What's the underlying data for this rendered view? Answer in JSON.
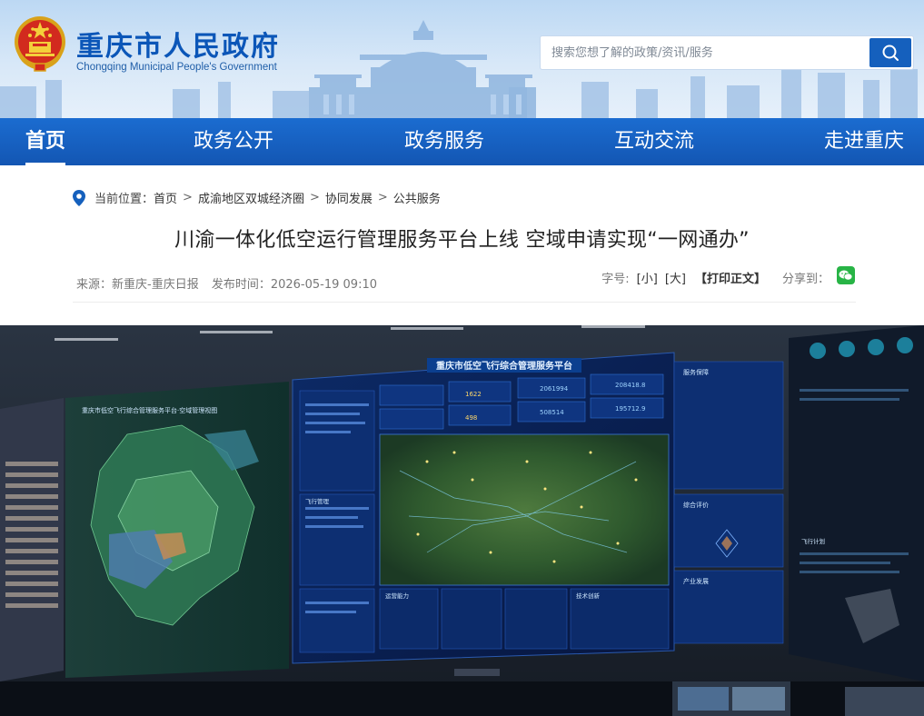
{
  "header": {
    "site_name": "重庆市人民政府",
    "site_name_en": "Chongqing Municipal People's Government",
    "search_placeholder": "搜索您想了解的政策/资讯/服务",
    "emblem_icon": "national-emblem-icon",
    "search_icon": "search-icon",
    "brand_color": "#0b56b8"
  },
  "nav": {
    "items": [
      {
        "label": "首页",
        "active": true
      },
      {
        "label": "政务公开",
        "active": false
      },
      {
        "label": "政务服务",
        "active": false
      },
      {
        "label": "互动交流",
        "active": false
      },
      {
        "label": "走进重庆",
        "active": false
      }
    ],
    "color": "#1560bd"
  },
  "breadcrumb": {
    "prefix": "当前位置：",
    "items": [
      "首页",
      "成渝地区双城经济圈",
      "协同发展",
      "公共服务"
    ],
    "separator": ">",
    "icon": "location-pin-icon"
  },
  "article": {
    "title": "川渝一体化低空运行管理服务平台上线 空域申请实现“一网通办”",
    "source": "来源：新重庆-重庆日报",
    "published": "发布时间：2026-05-19 09:10",
    "font_size_label": "字号:",
    "font_small": "[小]",
    "font_large": "[大]",
    "print": "【打印正文】",
    "share_label": "分享到：",
    "share_icon": "wechat-icon"
  },
  "photo": {
    "screen_title": "重庆市低空飞行综合管理服务平台",
    "left_screen_title": "重庆市低空飞行综合管理服务平台·空域管理视图",
    "panels": [
      "服务保障",
      "飞行管理",
      "运营能力",
      "技术创新",
      "产业发展",
      "综合评价",
      "飞行计划"
    ],
    "stats": [
      "208418.8",
      "2061994",
      "195712.9",
      "508514",
      "1622",
      "498"
    ]
  }
}
